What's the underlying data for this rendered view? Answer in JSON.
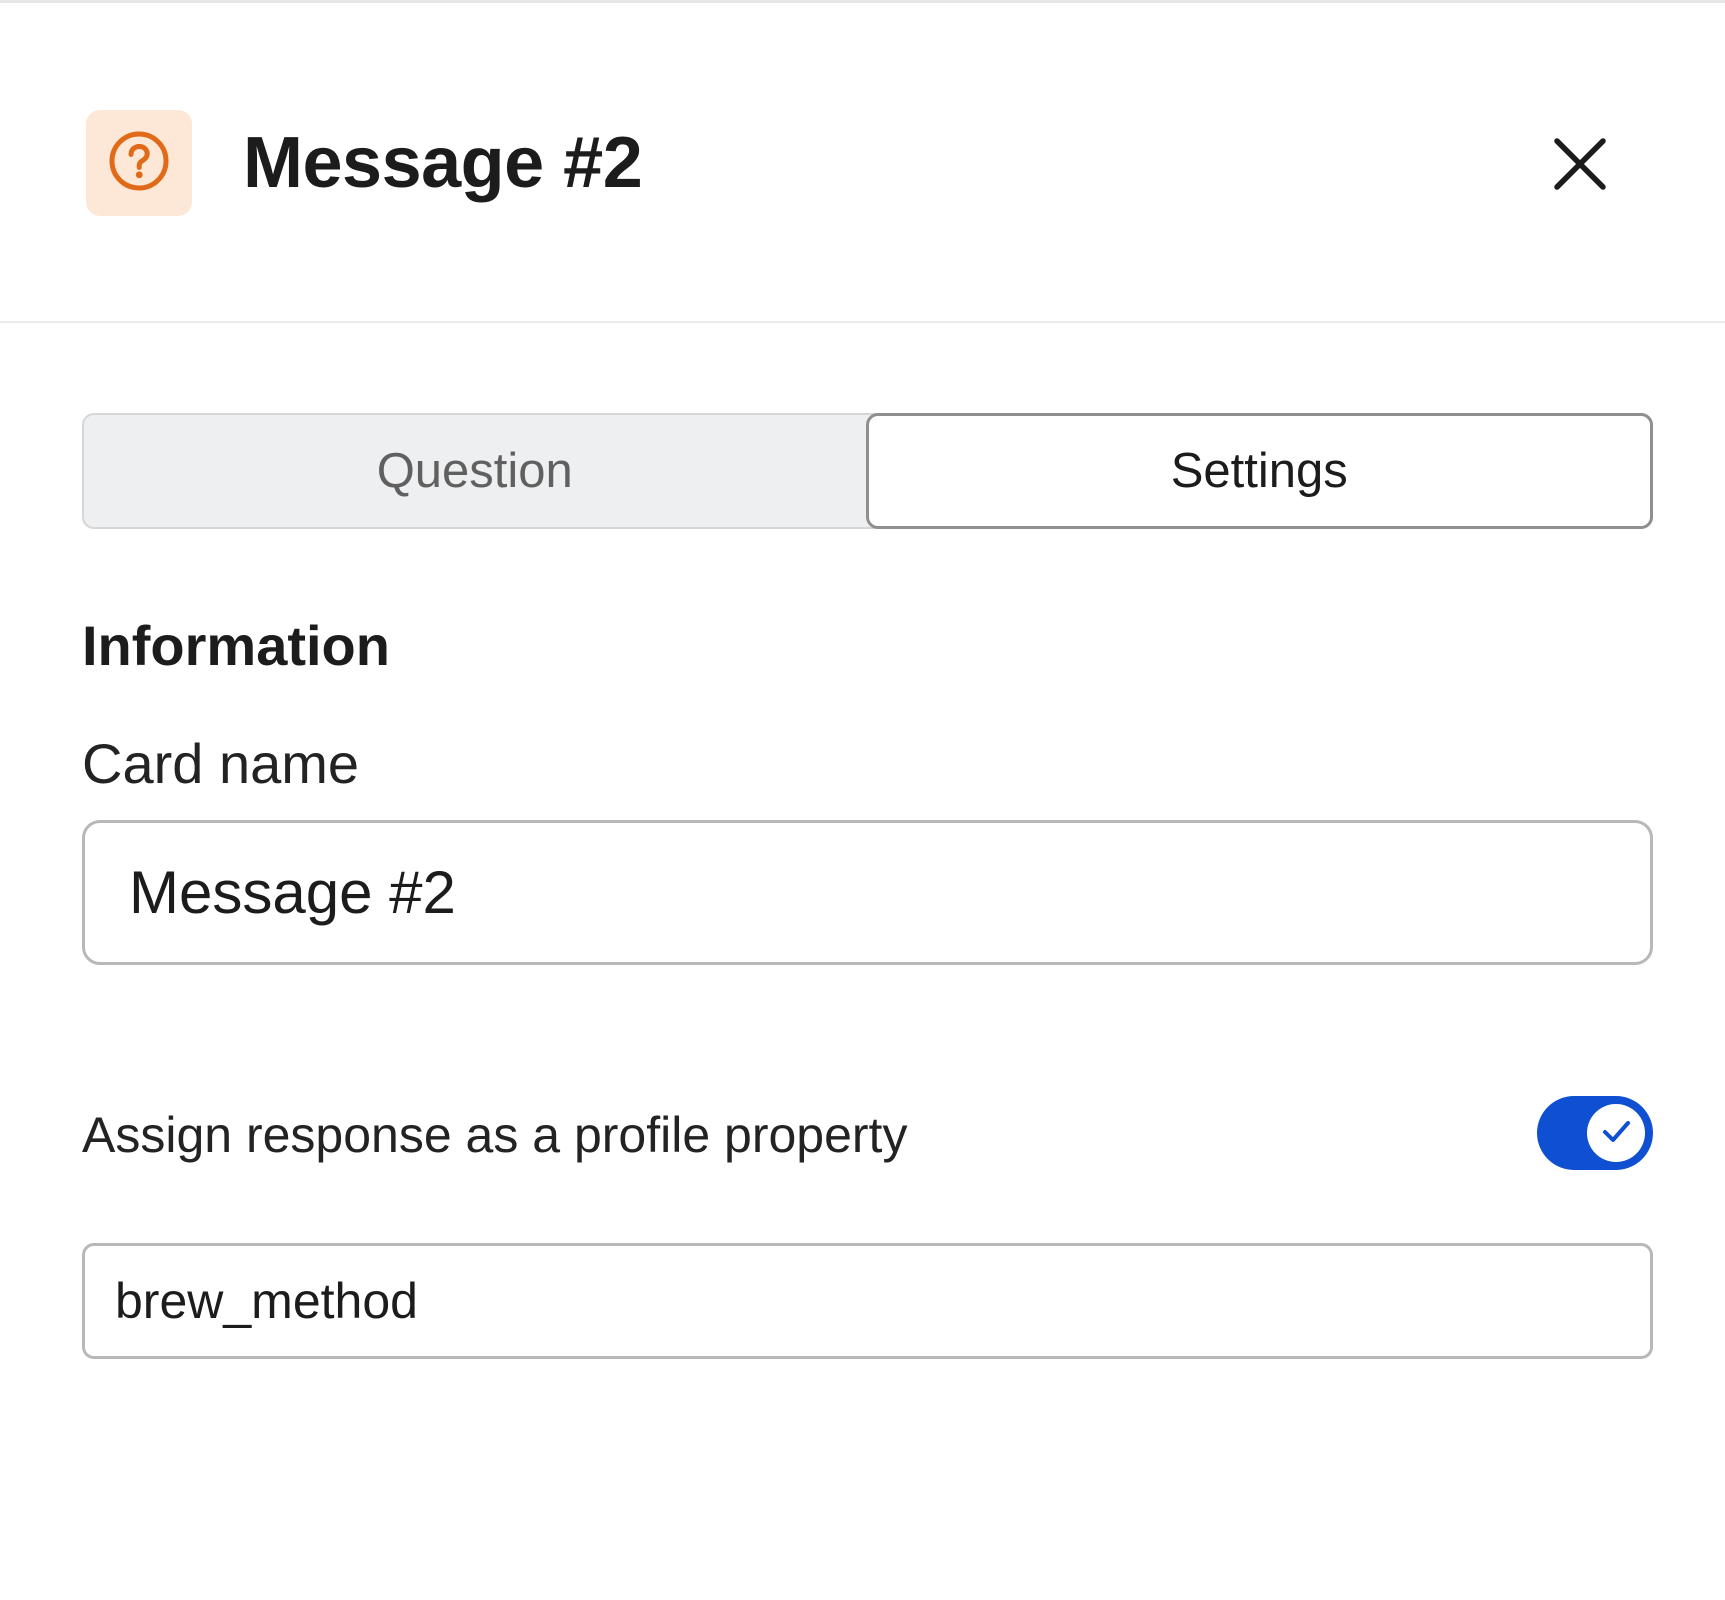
{
  "header": {
    "title": "Message #2",
    "icon": "question-circle-icon",
    "icon_color": "#e06a17",
    "icon_bg": "#fde7d6",
    "close_icon": "close-icon"
  },
  "tabs": [
    {
      "label": "Question",
      "active": false
    },
    {
      "label": "Settings",
      "active": true
    }
  ],
  "section": {
    "heading": "Information"
  },
  "card_name": {
    "label": "Card name",
    "value": "Message #2"
  },
  "profile_property": {
    "label": "Assign response as a profile property",
    "toggle_on": true,
    "toggle_color": "#0f4fd1",
    "value": "brew_method"
  }
}
